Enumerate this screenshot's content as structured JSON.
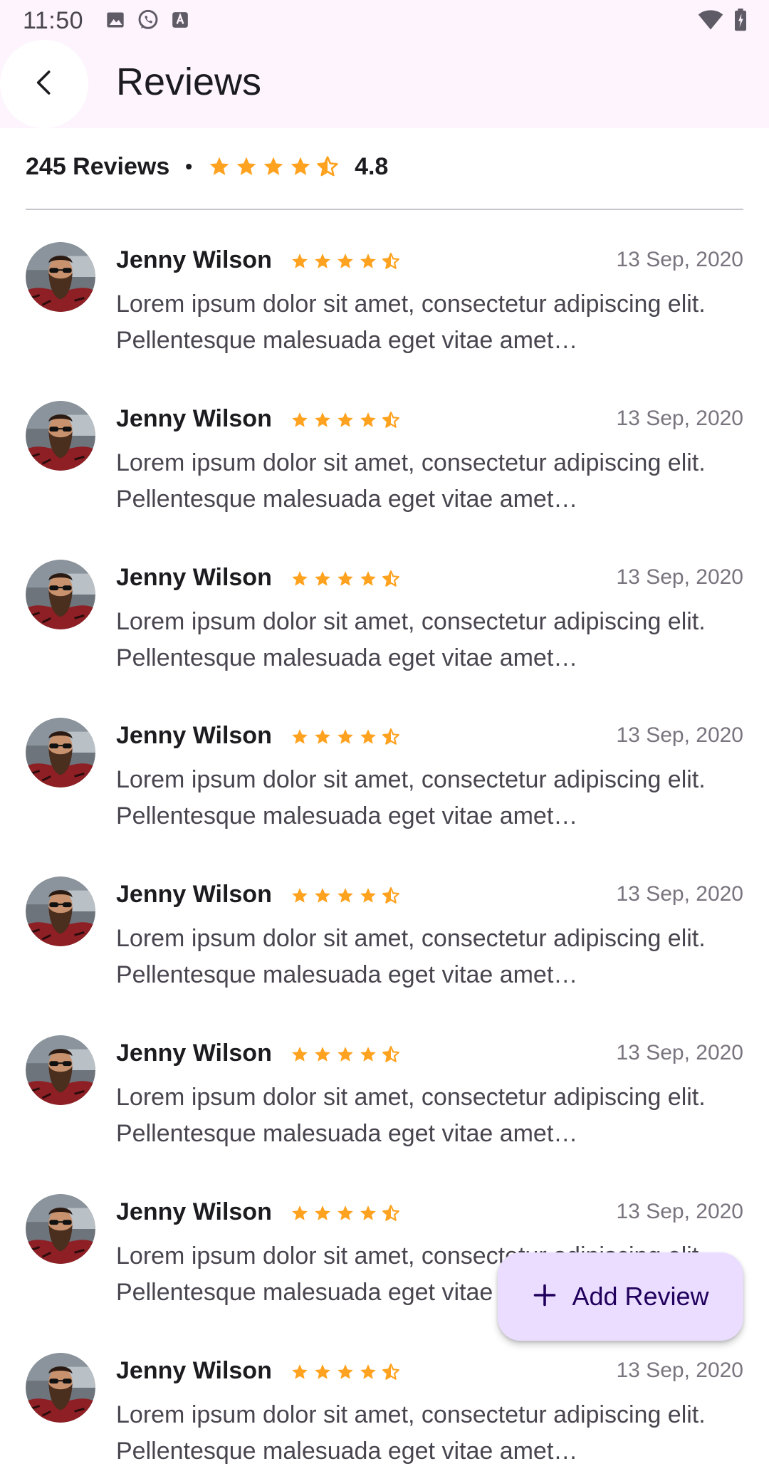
{
  "status_bar": {
    "time": "11:50",
    "left_icons": [
      "image-icon",
      "whatsapp-icon",
      "keyboard-a-icon"
    ],
    "right_icons": [
      "wifi-icon",
      "battery-icon"
    ]
  },
  "app_bar": {
    "title": "Reviews",
    "back_icon": "arrow-back-icon"
  },
  "summary": {
    "count_label": "245 Reviews",
    "separator": "•",
    "rating": "4.8",
    "stars": 4.5
  },
  "reviews": [
    {
      "name": "Jenny Wilson",
      "date": "13 Sep, 2020",
      "stars": 4.5,
      "text": "Lorem ipsum dolor sit amet, consectetur adipiscing elit. Pellentesque malesuada eget vitae amet…"
    },
    {
      "name": "Jenny Wilson",
      "date": "13 Sep, 2020",
      "stars": 4.5,
      "text": "Lorem ipsum dolor sit amet, consectetur adipiscing elit. Pellentesque malesuada eget vitae amet…"
    },
    {
      "name": "Jenny Wilson",
      "date": "13 Sep, 2020",
      "stars": 4.5,
      "text": "Lorem ipsum dolor sit amet, consectetur adipiscing elit. Pellentesque malesuada eget vitae amet…"
    },
    {
      "name": "Jenny Wilson",
      "date": "13 Sep, 2020",
      "stars": 4.5,
      "text": "Lorem ipsum dolor sit amet, consectetur adipiscing elit. Pellentesque malesuada eget vitae amet…"
    },
    {
      "name": "Jenny Wilson",
      "date": "13 Sep, 2020",
      "stars": 4.5,
      "text": "Lorem ipsum dolor sit amet, consectetur adipiscing elit. Pellentesque malesuada eget vitae amet…"
    },
    {
      "name": "Jenny Wilson",
      "date": "13 Sep, 2020",
      "stars": 4.5,
      "text": "Lorem ipsum dolor sit amet, consectetur adipiscing elit. Pellentesque malesuada eget vitae amet…"
    },
    {
      "name": "Jenny Wilson",
      "date": "13 Sep, 2020",
      "stars": 4.5,
      "text": "Lorem ipsum dolor sit amet, consectetur adipiscing elit. Pellentesque malesuada eget vitae amet…"
    },
    {
      "name": "Jenny Wilson",
      "date": "13 Sep, 2020",
      "stars": 4.5,
      "text": "Lorem ipsum dolor sit amet, consectetur adipiscing elit. Pellentesque malesuada eget vitae amet…"
    }
  ],
  "fab": {
    "label": "Add Review",
    "icon": "plus-icon"
  },
  "colors": {
    "star": "#ffa21f",
    "app_bar_bg": "#fdf4fd",
    "fab_bg": "#eaddff",
    "fab_text": "#21005d"
  }
}
